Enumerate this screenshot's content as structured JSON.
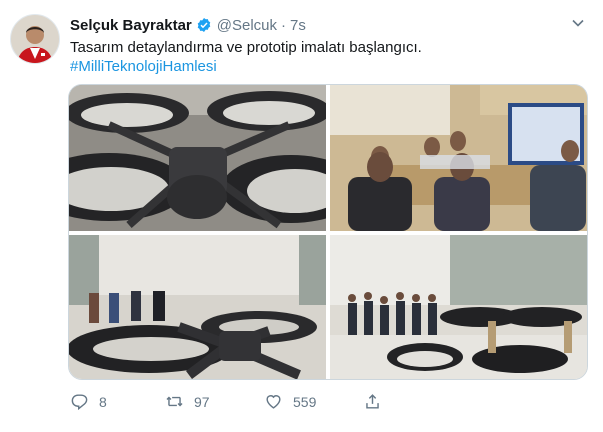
{
  "author": {
    "name": "Selçuk Bayraktar",
    "handle": "@Selcuk",
    "separator": "·",
    "time": "7s",
    "verified": true
  },
  "tweet": {
    "text": "Tasarım detaylandırma ve prototip imalatı başlangıcı.",
    "hashtag": "#MilliTeknolojiHamlesi"
  },
  "media": {
    "photos": [
      {
        "name": "drone-frame-closeup-photo"
      },
      {
        "name": "team-meeting-photo"
      },
      {
        "name": "workshop-drone-assembly-photo"
      },
      {
        "name": "team-group-photo"
      }
    ]
  },
  "actions": {
    "reply_count": "8",
    "retweet_count": "97",
    "like_count": "559"
  },
  "icons": {
    "verified": "verified-badge-icon",
    "caret": "chevron-down-icon",
    "reply": "reply-icon",
    "retweet": "retweet-icon",
    "like": "heart-icon",
    "share": "share-icon"
  },
  "colors": {
    "link": "#1b95e0",
    "muted": "#657786",
    "verified": "#1da1f2"
  }
}
